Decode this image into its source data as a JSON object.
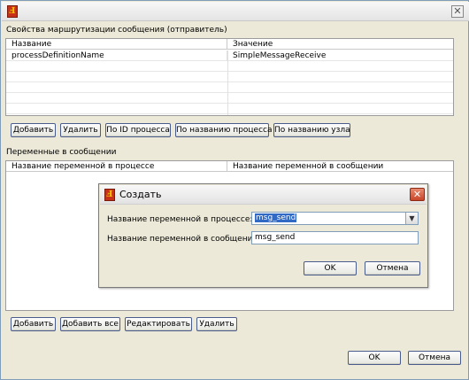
{
  "window": {
    "title": ""
  },
  "routing": {
    "section_title": "Свойства маршрутизации сообщения (отправитель)",
    "columns": [
      "Название",
      "Значение"
    ],
    "rows": [
      {
        "name": "processDefinitionName",
        "value": "SimpleMessageReceive"
      }
    ],
    "buttons": {
      "add": "Добавить",
      "delete": "Удалить",
      "by_process_id": "По ID процесса",
      "by_process_name": "По названию процесса",
      "by_node_name": "По названию узла"
    }
  },
  "variables": {
    "section_title": "Переменные в сообщении",
    "columns": [
      "Название переменной в процессе",
      "Название переменной в сообщении"
    ],
    "buttons": {
      "add": "Добавить",
      "add_all": "Добавить все",
      "edit": "Редактировать",
      "delete": "Удалить"
    }
  },
  "footer": {
    "ok": "OK",
    "cancel": "Отмена"
  },
  "dialog": {
    "title": "Создать",
    "process_var_label": "Название переменной в процессе:",
    "process_var_value": "msg_send",
    "message_var_label": "Название переменной в сообщении:",
    "message_var_value": "msg_send",
    "ok": "OK",
    "cancel": "Отмена"
  },
  "icons": {
    "app": "jbpm-app-icon",
    "close": "close-icon",
    "dropdown": "chevron-down-icon"
  },
  "colors": {
    "window_bg": "#ece9d8",
    "dialog_close": "#c7462a",
    "selection": "#316ac5"
  }
}
